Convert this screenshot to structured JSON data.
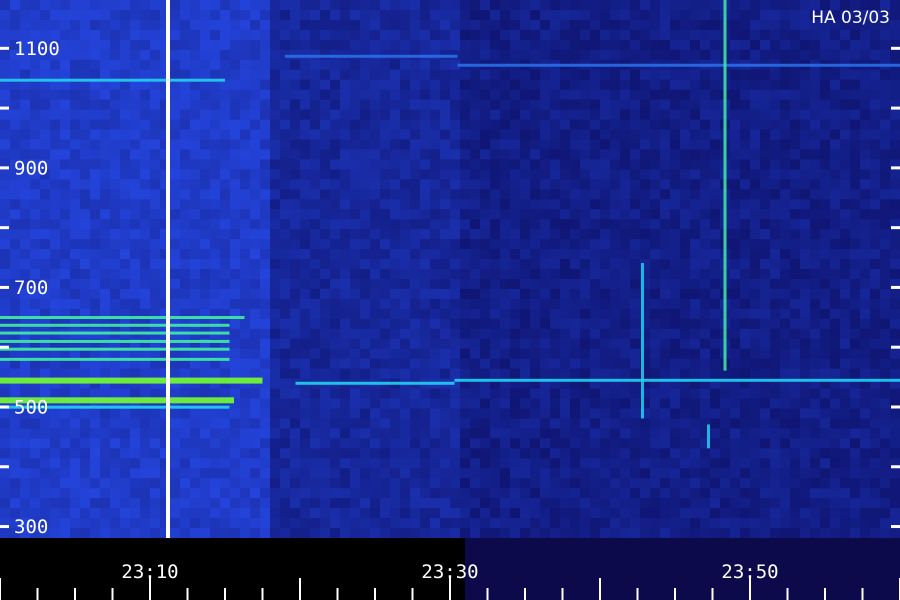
{
  "chart_data": {
    "type": "heatmap",
    "title": "",
    "xlabel": "",
    "ylabel": "",
    "station_label": "HA 03/03",
    "y_ticks": [
      "1100",
      "900",
      "700",
      "500",
      "300"
    ],
    "y_tick_values": [
      1100,
      900,
      700,
      500,
      300
    ],
    "x_ticks": [
      "23:10",
      "23:30",
      "23:50"
    ],
    "x_tick_values": [
      10,
      30,
      50
    ],
    "x_range_minutes": [
      0,
      60
    ],
    "y_range": [
      280,
      1180
    ],
    "marker_minute": 11.2,
    "bands": [
      {
        "y": 1045,
        "x0": 0,
        "x1": 15,
        "level": 0.45
      },
      {
        "y": 1085,
        "x0": 19,
        "x1": 30.5,
        "level": 0.1
      },
      {
        "y": 1070,
        "x0": 30.5,
        "x1": 60,
        "level": 0.28
      },
      {
        "y": 648,
        "x0": 0,
        "x1": 16.3,
        "level": 0.85
      },
      {
        "y": 635,
        "x0": 0,
        "x1": 15.3,
        "level": 0.6
      },
      {
        "y": 622,
        "x0": 0,
        "x1": 15.3,
        "level": 0.6
      },
      {
        "y": 608,
        "x0": 0,
        "x1": 15.3,
        "level": 0.65
      },
      {
        "y": 595,
        "x0": 0,
        "x1": 15.3,
        "level": 0.65
      },
      {
        "y": 578,
        "x0": 0,
        "x1": 15.3,
        "level": 0.75
      },
      {
        "y": 545,
        "x0": 0,
        "x1": 17.5,
        "level": 1.0
      },
      {
        "y": 538,
        "x0": 19.7,
        "x1": 30.3,
        "level": 0.55
      },
      {
        "y": 543,
        "x0": 30.3,
        "x1": 60,
        "level": 0.35
      },
      {
        "y": 512,
        "x0": 0,
        "x1": 15.6,
        "level": 0.95
      },
      {
        "y": 498,
        "x0": 0,
        "x1": 15.3,
        "level": 0.55
      }
    ],
    "vertical_bursts": [
      {
        "minute": 42.8,
        "y0": 480,
        "y1": 740,
        "level": 0.4
      },
      {
        "minute": 47.2,
        "y0": 430,
        "y1": 470,
        "level": 0.55
      },
      {
        "minute": 48.3,
        "y0": 560,
        "y1": 1180,
        "level": 0.75
      }
    ],
    "colors": {
      "low": "#0c0a4a",
      "mid": "#2533d6",
      "high": "#23d0f0",
      "peak": "#74ff2e",
      "marker": "#ffffff"
    }
  }
}
